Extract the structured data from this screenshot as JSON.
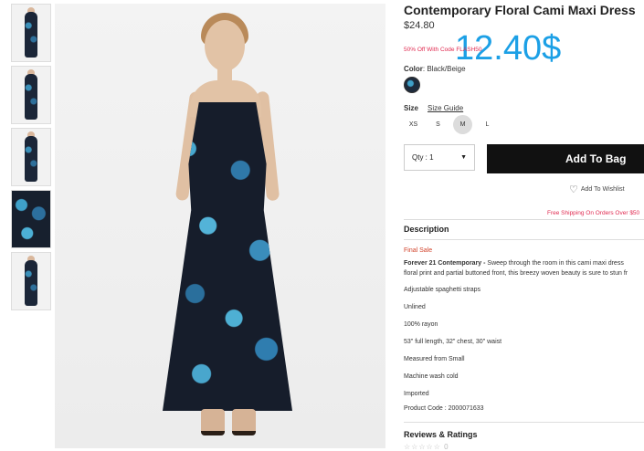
{
  "product": {
    "title": "Contemporary Floral Cami Maxi Dress",
    "price": "$24.80",
    "promo": "50% Off With Code FLASH50",
    "overlay_price": "12.40$",
    "color_label": "Color",
    "color_value": ": Black/Beige",
    "size_label": "Size",
    "size_guide": "Size Guide",
    "sizes": [
      "XS",
      "S",
      "M",
      "L"
    ],
    "selected_size": "M",
    "qty": "Qty : 1",
    "add_to_bag": "Add To Bag",
    "wishlist": "Add To Wishlist",
    "free_shipping": "Free Shipping On Orders Over $50"
  },
  "description": {
    "heading": "Description",
    "final_sale": "Final Sale",
    "brand": "Forever 21 Contemporary -",
    "line1": " Sweep through the room in this cami maxi dress",
    "line2": "floral print and partial buttoned front, this breezy woven beauty is sure to stun fr",
    "specs": [
      "Adjustable spaghetti straps",
      "Unlined",
      "100% rayon",
      "53\" full length, 32\" chest, 30\" waist",
      "Measured from Small",
      "Machine wash cold",
      "Imported",
      "Product Code : 2000071633"
    ]
  },
  "reviews": {
    "heading": "Reviews & Ratings",
    "stars": "☆☆☆☆☆ 0"
  },
  "colors": {
    "promo_red": "#e0294f",
    "overlay_blue": "#1ca0e6",
    "button_black": "#111111"
  }
}
